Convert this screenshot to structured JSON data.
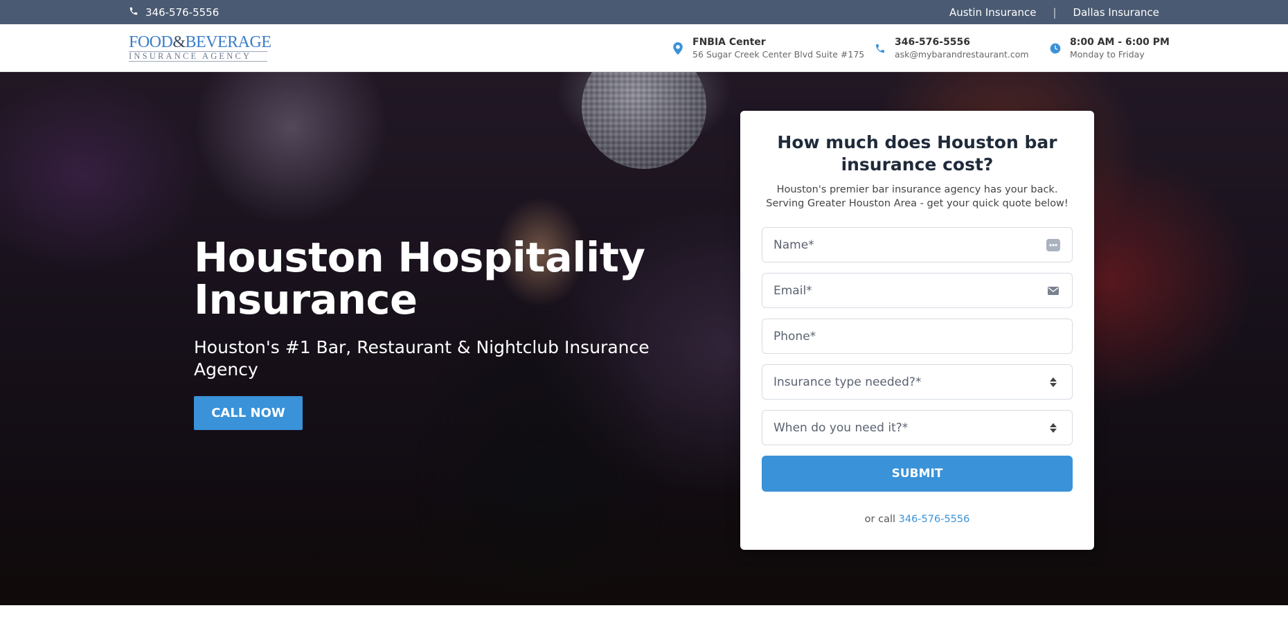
{
  "topbar": {
    "phone": "346-576-5556",
    "links": [
      "Austin Insurance",
      "Dallas Insurance"
    ],
    "separator": "|"
  },
  "header": {
    "logo_line1_a": "FOOD",
    "logo_line1_amp": "&",
    "logo_line1_b": "BEVERAGE",
    "logo_line2": "INSURANCE AGENCY",
    "location_title": "FNBIA Center",
    "location_address": "56 Sugar Creek Center Blvd Suite #175",
    "contact_phone": "346-576-5556",
    "contact_email": "ask@mybarandrestaurant.com",
    "hours_title": "8:00 AM - 6:00 PM",
    "hours_days": "Monday to Friday"
  },
  "hero": {
    "title": "Houston Hospitality Insurance",
    "subtitle": "Houston's #1 Bar, Restaurant & Nightclub Insurance Agency",
    "cta_label": "CALL NOW"
  },
  "form": {
    "heading": "How much does Houston bar insurance cost?",
    "description": "Houston's premier bar insurance agency has your back. Serving Greater Houston Area - get your quick quote below!",
    "name_placeholder": "Name*",
    "email_placeholder": "Email*",
    "phone_placeholder": "Phone*",
    "insurance_type_placeholder": "Insurance type needed?*",
    "when_placeholder": "When do you need it?*",
    "submit_label": "SUBMIT",
    "or_call_prefix": "or call",
    "or_call_phone": "346-576-5556"
  },
  "colors": {
    "topbar": "#4a5a72",
    "accent": "#3a92d8"
  }
}
